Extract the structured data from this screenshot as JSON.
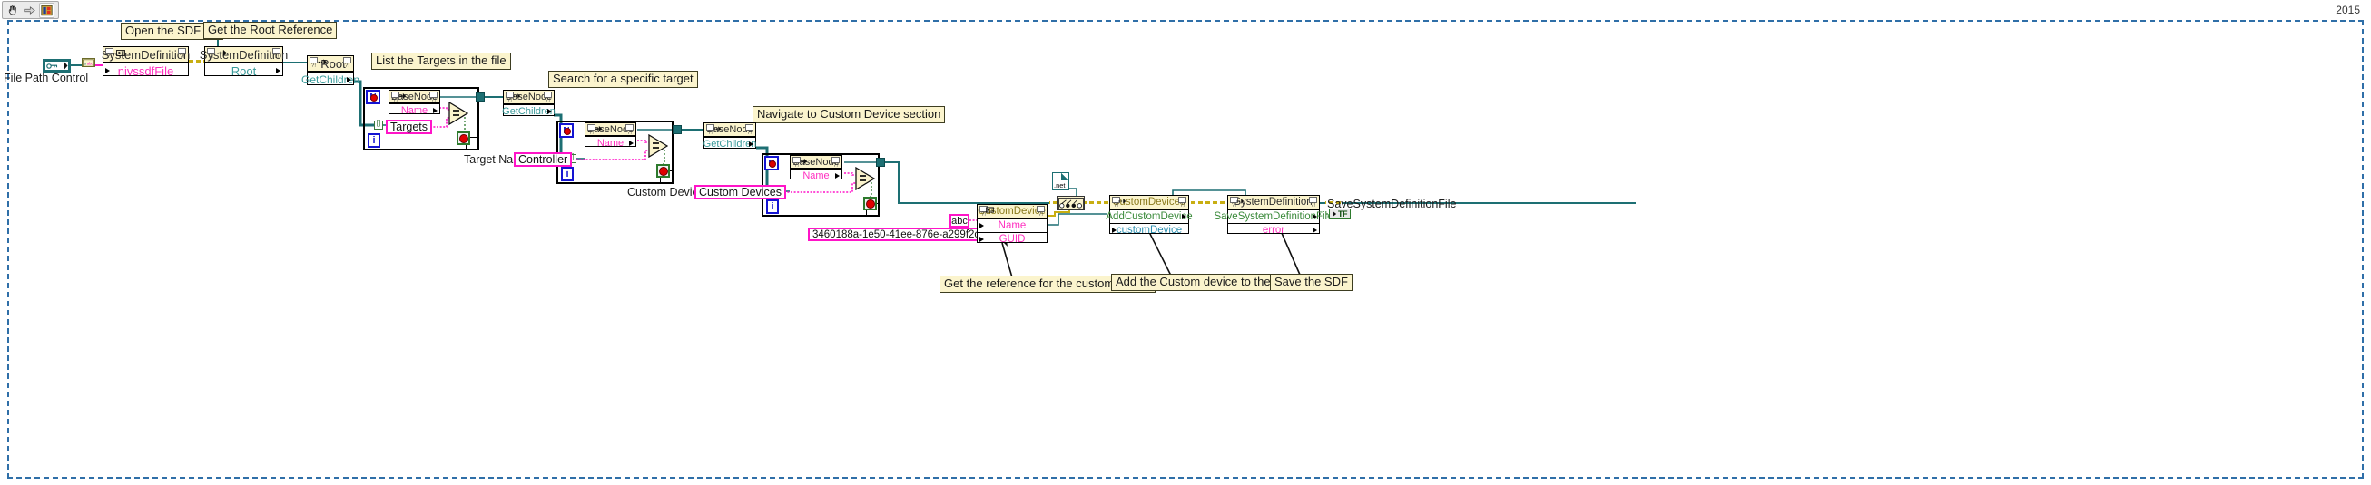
{
  "window": {
    "version_label": "2015",
    "toolbar": {
      "icons": [
        {
          "name": "hand-tool-icon",
          "glyph": "✋"
        },
        {
          "name": "arrow-right-icon",
          "glyph": "➪"
        },
        {
          "name": "vi-icon",
          "glyph": "▣"
        }
      ]
    }
  },
  "labels": {
    "file_path_control": "File Path Control",
    "target_name": "Target Name",
    "custom_device_list": "Custom Device List",
    "save_system_definition_file": "SaveSystemDefinitionFile"
  },
  "comments": [
    {
      "id": "open-sdf",
      "text": "Open the SDF file"
    },
    {
      "id": "get-root",
      "text": "Get the Root Reference"
    },
    {
      "id": "list-targets",
      "text": "List the Targets in the file"
    },
    {
      "id": "search-target",
      "text": "Search for a specific target"
    },
    {
      "id": "navigate-cd",
      "text": "Navigate to Custom Device section"
    },
    {
      "id": "get-reference",
      "text": "Get the reference for the custom device"
    },
    {
      "id": "add-custom-device",
      "text": "Add the Custom device to the SDF"
    },
    {
      "id": "save-sdf",
      "text": "Save the SDF"
    }
  ],
  "nodes": {
    "open_sdf": {
      "header": "SystemDefinition",
      "glyph": "constructor-icon",
      "rows": [
        {
          "text": "nivssdfFile",
          "color": "magenta"
        }
      ]
    },
    "root_property": {
      "header": "SystemDefinition",
      "glyph": "property-icon",
      "rows": [
        {
          "text": "Root",
          "color": "teal"
        }
      ]
    },
    "root_getchildren": {
      "header": "Root",
      "glyph": "invoke-icon",
      "rows": [
        {
          "text": "GetChildren",
          "color": "teal"
        }
      ]
    },
    "basenode_name_1": {
      "header": "BaseNode",
      "glyph": "property-icon",
      "rows": [
        {
          "text": "Name",
          "color": "magenta"
        }
      ]
    },
    "basenode_getchildren_1": {
      "header": "BaseNode",
      "glyph": "invoke-icon",
      "rows": [
        {
          "text": "GetChildren",
          "color": "teal"
        }
      ]
    },
    "basenode_name_2": {
      "header": "BaseNode",
      "glyph": "property-icon",
      "rows": [
        {
          "text": "Name",
          "color": "magenta"
        }
      ]
    },
    "basenode_getchildren_2": {
      "header": "BaseNode",
      "glyph": "invoke-icon",
      "rows": [
        {
          "text": "GetChildren",
          "color": "teal"
        }
      ]
    },
    "basenode_name_3": {
      "header": "BaseNode",
      "glyph": "property-icon",
      "rows": [
        {
          "text": "Name",
          "color": "magenta"
        }
      ]
    },
    "customdevice_ctor": {
      "header": "CustomDevice",
      "glyph": "constructor-icon",
      "rows": [
        {
          "text": "Name",
          "color": "magenta"
        },
        {
          "text": "GUID",
          "color": "magenta"
        }
      ]
    },
    "customdevices_add": {
      "header": "CustomDevices",
      "glyph": "invoke-icon",
      "rows": [
        {
          "text": "AddCustomDevice",
          "color": "green"
        },
        {
          "text": "customDevice",
          "color": "blue"
        }
      ]
    },
    "systemdefinition_save": {
      "header": "SystemDefinition",
      "glyph": "invoke-icon",
      "rows": [
        {
          "text": "SaveSystemDefinitionFile",
          "color": "green"
        },
        {
          "text": "error",
          "color": "magenta"
        }
      ]
    }
  },
  "constants": {
    "targets": "Targets",
    "controller": "Controller",
    "custom_devices": "Custom Devices",
    "guid": "3460188a-1e50-41ee-876e-a299f2c56c18",
    "abc": "abc",
    "tf_indicator": "TF"
  },
  "loop_indicators": {
    "count_terminal": "N",
    "iteration_terminal": "i"
  },
  "colors": {
    "wire_refnum": "#1d6f73",
    "wire_string": "#ff14c8",
    "wire_error": "#b8a10a",
    "wire_boolean": "#2d7a2d",
    "comment_bg": "#fbf4cd",
    "node_header_bg": "#fbf4cd",
    "frame_dash": "#2f6fa8"
  }
}
